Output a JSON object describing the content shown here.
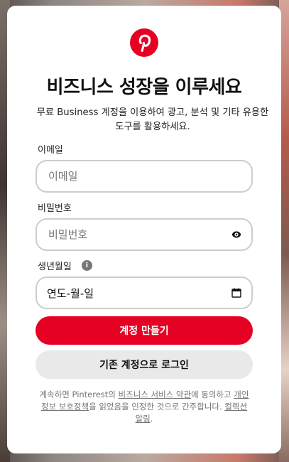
{
  "brand": {
    "logo": "pinterest-logo",
    "accent": "#e60023"
  },
  "title": "비즈니스 성장을 이루세요",
  "subtitle": "무료 Business 계정을 이용하여 광고, 분석 및 기타 유용한 도구를 활용하세요.",
  "form": {
    "email_label": "이메일",
    "email_placeholder": "이메일",
    "password_label": "비밀번호",
    "password_placeholder": "비밀번호",
    "birthdate_label": "생년월일",
    "birthdate_placeholder": "연도-월-일"
  },
  "buttons": {
    "create_account": "계정 만들기",
    "login_existing": "기존 계정으로 로그인"
  },
  "legal": {
    "prefix": "계속하면 Pinterest의 ",
    "terms_link": "비즈니스 서비스 약관",
    "middle1": "에 동의하고 ",
    "privacy_link": "개인정보 보호정책",
    "middle2": "을 읽었음을 인정한 것으로 간주합니다. ",
    "collection_link": "컬렉션 알림",
    "suffix": "."
  }
}
